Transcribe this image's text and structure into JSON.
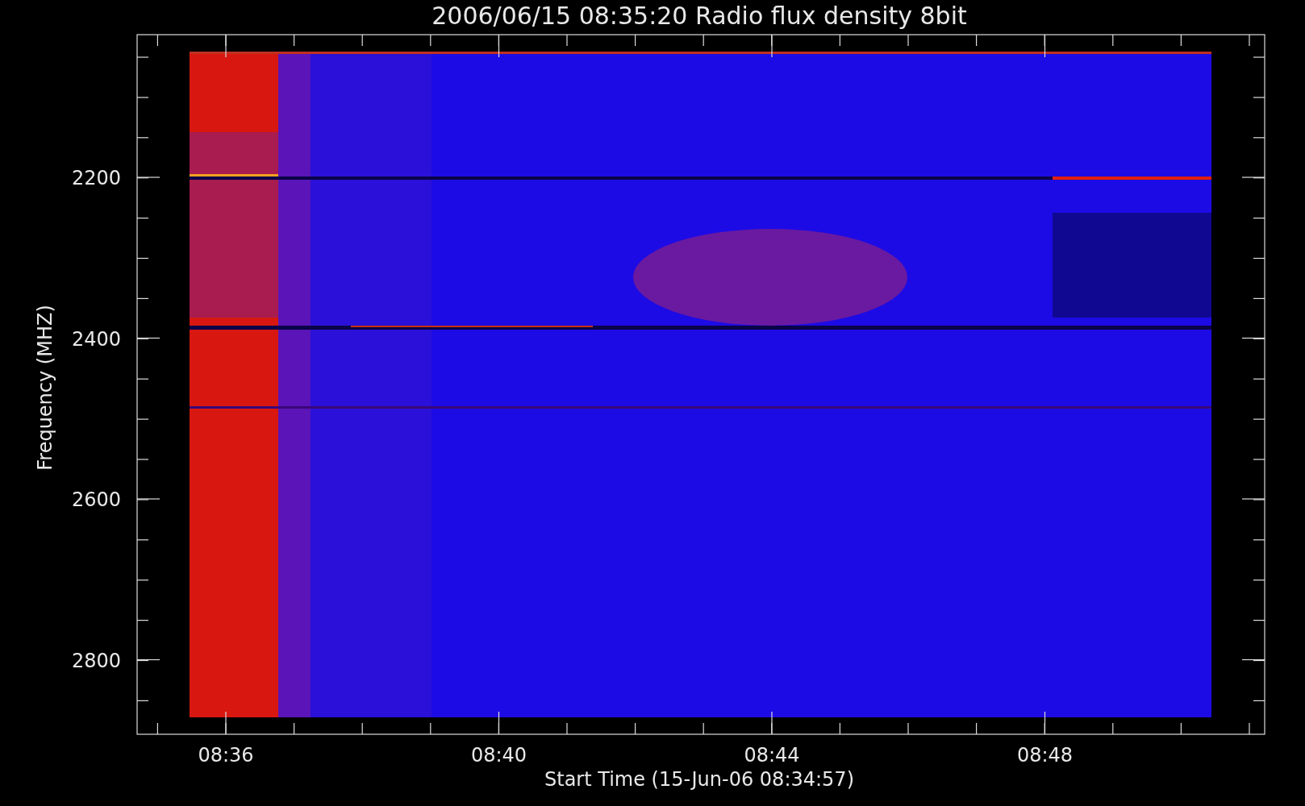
{
  "title": "2006/06/15 08:35:20 Radio flux density 8bit",
  "y_axis": {
    "label": "Frequency (MHZ)",
    "ticks": [
      "2200",
      "2400",
      "2600",
      "2800"
    ]
  },
  "x_axis": {
    "label": "Start Time (15-Jun-06 08:34:57)",
    "ticks": [
      "08:36",
      "08:40",
      "08:44",
      "08:48"
    ]
  }
}
